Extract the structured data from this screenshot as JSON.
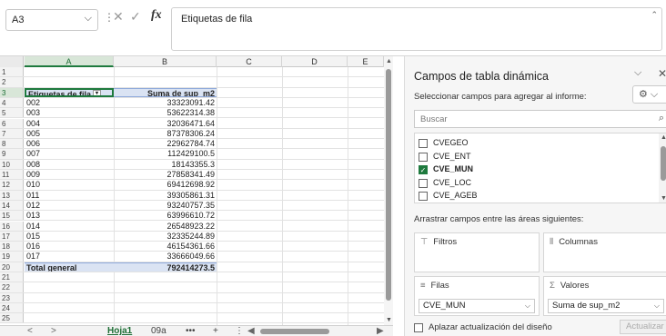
{
  "formula_bar": {
    "name_box": "A3",
    "name_box_arrow": "⌵",
    "dots": "⋮",
    "cancel": "✕",
    "enter": "✓",
    "fx": "fx",
    "content": "Etiquetas de fila",
    "collapse": "⌃"
  },
  "grid": {
    "columns": [
      "A",
      "B",
      "C",
      "D",
      "E"
    ],
    "selected_column": "A",
    "header_row": {
      "row": "3",
      "label": "Etiquetas de fila",
      "filter": "▾",
      "value_header": "Suma de sup_m2"
    },
    "rows": [
      {
        "row": "1",
        "a": "",
        "b": ""
      },
      {
        "row": "2",
        "a": "",
        "b": ""
      },
      {
        "row": "4",
        "a": "002",
        "b": "33323091.42"
      },
      {
        "row": "5",
        "a": "003",
        "b": "53622314.38"
      },
      {
        "row": "6",
        "a": "004",
        "b": "32036471.64"
      },
      {
        "row": "7",
        "a": "005",
        "b": "87378306.24"
      },
      {
        "row": "8",
        "a": "006",
        "b": "22962784.74"
      },
      {
        "row": "9",
        "a": "007",
        "b": "112429100.5"
      },
      {
        "row": "10",
        "a": "008",
        "b": "18143355.3"
      },
      {
        "row": "11",
        "a": "009",
        "b": "27858341.49"
      },
      {
        "row": "12",
        "a": "010",
        "b": "69412698.92"
      },
      {
        "row": "13",
        "a": "011",
        "b": "39305861.31"
      },
      {
        "row": "14",
        "a": "012",
        "b": "93240757.35"
      },
      {
        "row": "15",
        "a": "013",
        "b": "63996610.72"
      },
      {
        "row": "16",
        "a": "014",
        "b": "26548923.22"
      },
      {
        "row": "17",
        "a": "015",
        "b": "32335244.89"
      },
      {
        "row": "18",
        "a": "016",
        "b": "46154361.66"
      },
      {
        "row": "19",
        "a": "017",
        "b": "33666049.66"
      }
    ],
    "total_row": {
      "row": "20",
      "label": "Total general",
      "value": "792414273.5"
    },
    "empty_rows": [
      "21",
      "22",
      "23",
      "24",
      "25"
    ]
  },
  "scroll": {
    "up": "▲",
    "down": "▼",
    "left": "◀",
    "right": "▶"
  },
  "sheet_tabs": {
    "prev": "<",
    "next": ">",
    "tabs": [
      "Hoja1",
      "09a"
    ],
    "active": "Hoja1",
    "more": "•••",
    "add": "+",
    "options": "⋮"
  },
  "pivot_pane": {
    "title": "Campos de tabla dinámica",
    "dropdown_icon": "⌵",
    "close_icon": "✕",
    "subtitle": "Seleccionar campos para agregar al informe:",
    "gear": "⚙ ⌵",
    "search_placeholder": "Buscar",
    "search_icon": "⌕",
    "fields": [
      {
        "label": "CVEGEO",
        "checked": false
      },
      {
        "label": "CVE_ENT",
        "checked": false
      },
      {
        "label": "CVE_MUN",
        "checked": true
      },
      {
        "label": "CVE_LOC",
        "checked": false
      },
      {
        "label": "CVE_AGEB",
        "checked": false
      }
    ],
    "checkmark": "✓",
    "drag_label": "Arrastrar campos entre las áreas siguientes:",
    "areas": {
      "filters": {
        "icon": "⊤",
        "label": "Filtros"
      },
      "columns": {
        "icon": "⦀",
        "label": "Columnas"
      },
      "rows": {
        "icon": "≡",
        "label": "Filas",
        "item": "CVE_MUN"
      },
      "values": {
        "icon": "Σ",
        "label": "Valores",
        "item": "Suma de sup_m2"
      }
    },
    "item_dropdown": "⌵",
    "defer_label": "Aplazar actualización del diseño",
    "update_button": "Actualizar"
  }
}
